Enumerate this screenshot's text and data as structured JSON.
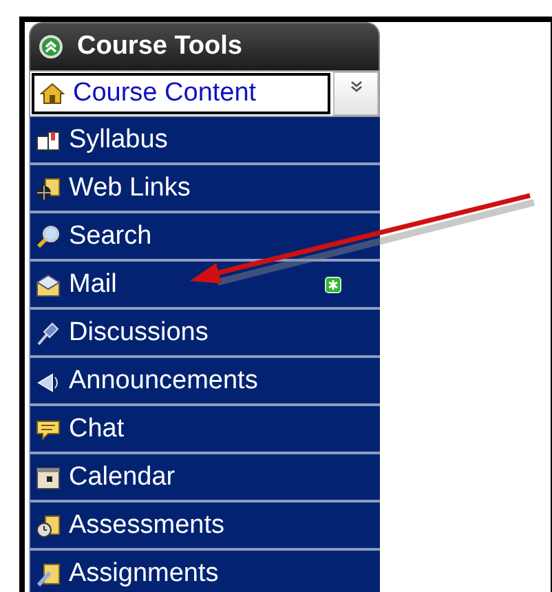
{
  "panel": {
    "title": "Course Tools",
    "expanded": true
  },
  "items": [
    {
      "label": "Course Content",
      "selected": true,
      "new": false
    },
    {
      "label": "Syllabus",
      "selected": false,
      "new": false
    },
    {
      "label": "Web Links",
      "selected": false,
      "new": false
    },
    {
      "label": "Search",
      "selected": false,
      "new": false
    },
    {
      "label": "Mail",
      "selected": false,
      "new": true
    },
    {
      "label": "Discussions",
      "selected": false,
      "new": false
    },
    {
      "label": "Announcements",
      "selected": false,
      "new": false
    },
    {
      "label": "Chat",
      "selected": false,
      "new": false
    },
    {
      "label": "Calendar",
      "selected": false,
      "new": false
    },
    {
      "label": "Assessments",
      "selected": false,
      "new": false
    },
    {
      "label": "Assignments",
      "selected": false,
      "new": false
    }
  ]
}
